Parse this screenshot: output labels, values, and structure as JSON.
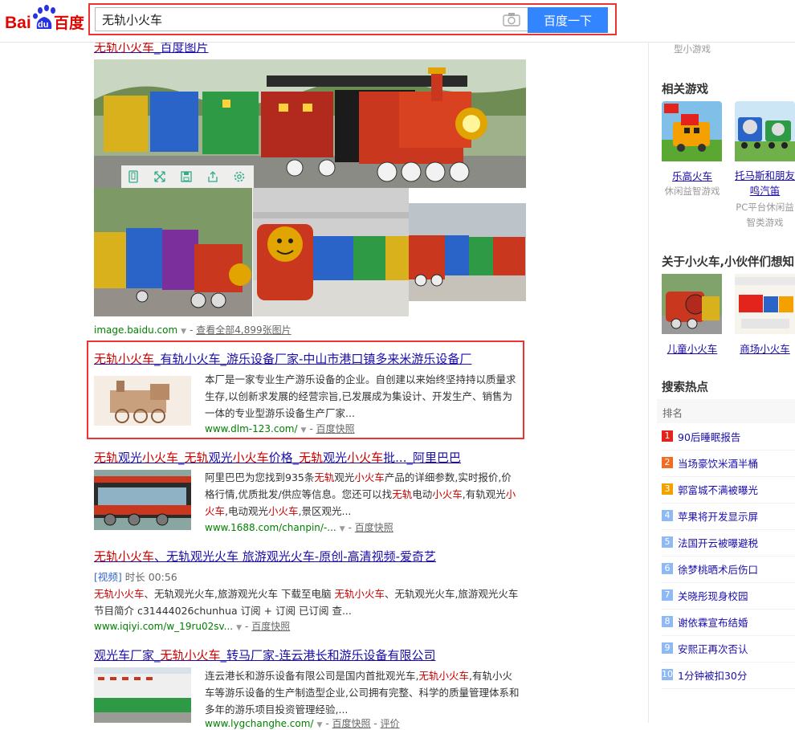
{
  "header": {
    "logo_text_1": "Bai",
    "logo_text_2": "du",
    "logo_text_3": "百度",
    "query": "无轨小火车",
    "search_button": "百度一下"
  },
  "results": {
    "image_block": {
      "title_hl": "无轨小火车",
      "title_rest": "_百度图片",
      "source": "image.baidu.com",
      "more_link": "查看全部4,899张图片"
    },
    "r1": {
      "title_hl": "无轨小火车",
      "title_rest": "_有轨小火车_游乐设备厂家-中山市港口镇多来米游乐设备厂",
      "snippet": "本厂是一家专业生产游乐设备的企业。自创建以来始终坚持持以质量求生存,以创新求发展的经营宗旨,已发展成为集设计、开发生产、销售为一体的专业型游乐设备生产厂家...",
      "url": "www.dlm-123.com/",
      "cache": "百度快照"
    },
    "r2": {
      "t1": "无轨",
      "t2": "观光",
      "t3": "小火车",
      "t4": "_",
      "t5": "无轨",
      "t6": "观光",
      "t7": "小火车",
      "t8": "价格_",
      "t9": "无轨",
      "t10": "观光",
      "t11": "小火车",
      "t12": "批..._阿里巴巴",
      "s1": "阿里巴巴为您找到935条",
      "s2": "无轨",
      "s3": "观光",
      "s4": "小火车",
      "s5": "产品的详细参数,实时报价,价格行情,优质批发/供应等信息。您还可以找",
      "s6": "无轨",
      "s7": "电动",
      "s8": "小火车",
      "s9": ",有轨观光",
      "s10": "小火车",
      "s11": ",电动观光",
      "s12": "小火车",
      "s13": ",景区观光...",
      "url": "www.1688.com/chanpin/-...",
      "cache": "百度快照"
    },
    "r3": {
      "title_hl": "无轨小火车",
      "title_rest": "、无轨观光火车 旅游观光火车-原创-高清视频-爱奇艺",
      "video_tag": "[视频]",
      "duration": "时长 00:56",
      "s1": "无轨小火车",
      "s2": "、无轨观光火车,旅游观光火车 下载至电脑 ",
      "s3": "无轨小火车",
      "s4": "、无轨观光火车,旅游观光火车 节目简介 c31444026chunhua 订阅 + 订阅 已订阅 查...",
      "url": "www.iqiyi.com/w_19ru02sv...",
      "cache": "百度快照"
    },
    "r4": {
      "title_a": "观光车厂家_",
      "title_hl": "无轨小火车",
      "title_b": "_转马厂家-连云港长和游乐设备有限公司",
      "s1": "连云港长和游乐设备有限公司是国内首批观光车,",
      "s2": "无轨小火车",
      "s3": ",有轨小火车等游乐设备的生产制造型企业,公司拥有完整、科学的质量管理体系和多年的游乐项目投资管理经验,...",
      "url": "www.lygchanghe.com/",
      "cache": "百度快照",
      "eval": "评价"
    }
  },
  "sidebar": {
    "top_sub": "型小游戏",
    "games_title": "相关游戏",
    "game1_name": "乐高火车",
    "game1_sub": "休闲益智游戏",
    "game2_name": "托马斯和朋友鸣汽笛",
    "game2_sub": "PC平台休闲益智类游戏",
    "about_title": "关于小火车,小伙伴们想知",
    "about1": "儿童小火车",
    "about2": "商场小火车",
    "hot_title": "搜索热点",
    "rank_header": "排名",
    "hot_items": [
      {
        "n": "1",
        "t": "90后睡眠报告"
      },
      {
        "n": "2",
        "t": "当场豪饮米酒半桶"
      },
      {
        "n": "3",
        "t": "郭富城不满被曝光"
      },
      {
        "n": "4",
        "t": "苹果将开发显示屏"
      },
      {
        "n": "5",
        "t": "法国开云被曝避税"
      },
      {
        "n": "6",
        "t": "徐梦桃晒术后伤口"
      },
      {
        "n": "7",
        "t": "关晓彤现身校园"
      },
      {
        "n": "8",
        "t": "谢依霖宣布结婚"
      },
      {
        "n": "9",
        "t": "安熙正再次否认"
      },
      {
        "n": "10",
        "t": "1分钟被扣30分"
      }
    ]
  },
  "colors": {
    "hot_top": [
      "#e2241d",
      "#f26b22",
      "#f4a100"
    ],
    "hot_rest": "#8eb9f5"
  }
}
